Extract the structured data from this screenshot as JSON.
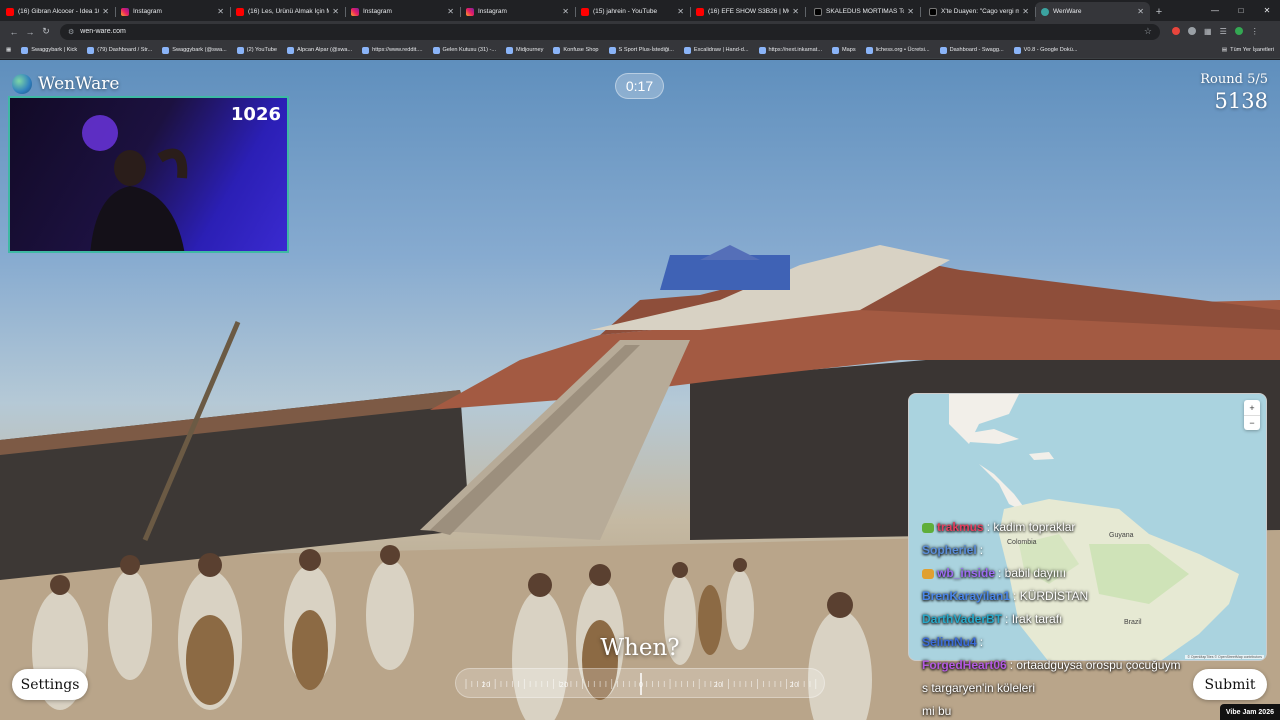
{
  "browser": {
    "tabs": [
      {
        "title": "(16) Gibran Alcocer - Idea 10",
        "icon": "youtube-icon"
      },
      {
        "title": "Instagram",
        "icon": "instagram-icon"
      },
      {
        "title": "(16) Les, Ürünü Almak İçin Mi",
        "icon": "youtube-icon"
      },
      {
        "title": "Instagram",
        "icon": "instagram-icon"
      },
      {
        "title": "Instagram",
        "icon": "instagram-icon"
      },
      {
        "title": "(15) jahrein - YouTube",
        "icon": "youtube-icon"
      },
      {
        "title": "(16) EFE SHOW S3B26 | MÖSY",
        "icon": "youtube-icon"
      },
      {
        "title": "SKALEDUS MORTIMAS Topluluk",
        "icon": "x-icon"
      },
      {
        "title": "X'te Duayen: \"Cago vergi mü?",
        "icon": "x-icon"
      },
      {
        "title": "WenWare",
        "icon": "wenware-icon",
        "active": true
      }
    ],
    "url": "wen-ware.com",
    "bookmarks": [
      "Swaggybark | Kick",
      "(79) Dashboard / Str...",
      "Swaggybark (@swa...",
      "(2) YouTube",
      "Alpcan Alpar (@swa...",
      "https://www.reddit....",
      "Gelen Kutusu (31) -...",
      "Midjourney",
      "Konfuse Shop",
      "S Sport Plus-İstediği...",
      "Excalidraw | Hand-d...",
      "https://next.inkarnat...",
      "Maps",
      "lichess.org • Ücretsi...",
      "Dashboard - Swagg...",
      "V0.8 - Google Dokü..."
    ],
    "bookmarks_right": "Tüm Yer İşaretleri"
  },
  "game": {
    "brand": "WenWare",
    "timer": "0:17",
    "round_label": "Round 5/5",
    "score": "5138",
    "prompt": "When?",
    "settings_label": "Settings",
    "submit_label": "Submit",
    "badge": "Vibe Jam 2026",
    "map_labels": [
      "Colombia",
      "Brazil",
      "Guyana"
    ],
    "map_attribution": "© OpenMapTiles © OpenStreetMap contributors",
    "slider_ticks": [
      "20",
      "20",
      "0",
      "20",
      "20"
    ]
  },
  "stream": {
    "viewer_count": "1026",
    "chat": [
      {
        "user": "trakmus",
        "message": ": kadim topraklar",
        "color": "#e3405f",
        "badge": "#5fae3a"
      },
      {
        "user": "Sopheriel",
        "message": ":",
        "color": "#5a8dd8"
      },
      {
        "user": "wb_inside",
        "message": ": babil dayıııı",
        "color": "#9b6bf0",
        "badge": "#e0a030"
      },
      {
        "user": "BrenKarayilan1",
        "message": ": KÜRDİSTAN",
        "color": "#4a86e8"
      },
      {
        "user": "DarthVaderBT",
        "message": ": Irak tarafı",
        "color": "#27a9c9"
      },
      {
        "user": "SelimNu4",
        "message": ":",
        "color": "#3b6bd8"
      },
      {
        "user": "ForgedHeart06",
        "message": ": ortaadguysa orospu çocuğuym",
        "color": "#b35ae0"
      },
      {
        "user": "",
        "message": "s targaryen'in köleleri"
      },
      {
        "user": "",
        "message": "mi bu"
      }
    ]
  }
}
